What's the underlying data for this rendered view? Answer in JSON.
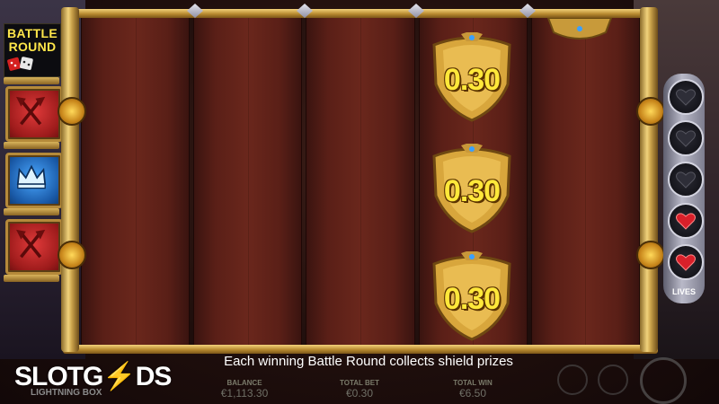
{
  "battle_round": {
    "label_line1": "BATTLE",
    "label_line2": "ROUND",
    "icon": "dice-icon"
  },
  "left_prizes": [
    {
      "type": "red",
      "icon": "crossed-axes-icon"
    },
    {
      "type": "blue",
      "icon": "crown-icon"
    },
    {
      "type": "red",
      "icon": "crossed-axes-icon"
    }
  ],
  "shields": [
    {
      "value": "0.30"
    },
    {
      "value": "0.30"
    },
    {
      "value": "0.30"
    }
  ],
  "lives": {
    "label": "LIVES",
    "slots": [
      {
        "state": "empty",
        "icon": "heart-empty-icon"
      },
      {
        "state": "empty",
        "icon": "heart-empty-icon"
      },
      {
        "state": "empty",
        "icon": "heart-empty-icon"
      },
      {
        "state": "full",
        "icon": "heart-full-icon"
      },
      {
        "state": "full",
        "icon": "heart-full-icon"
      }
    ]
  },
  "message": "Each winning Battle Round collects shield prizes",
  "footer": {
    "balance_label": "BALANCE",
    "balance_value": "€1,113.30",
    "total_bet_label": "TOTAL BET",
    "total_bet_value": "€0.30",
    "total_win_label": "TOTAL WIN",
    "total_win_value": "€6.50"
  },
  "watermark": {
    "logo_text_1": "SLOT",
    "logo_text_2": "G",
    "logo_text_3": "DS",
    "game_logo": "LIGHTNING BOX"
  },
  "colors": {
    "shield_text": "#ffe83a",
    "battle_text": "#ffe64a",
    "gold": "#d8b35a",
    "heart_red": "#d8202a"
  }
}
